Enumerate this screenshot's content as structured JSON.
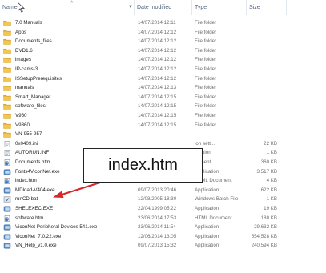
{
  "header": {
    "name": "Name",
    "date_modified": "Date modified",
    "type": "Type",
    "size": "Size",
    "sort_indicator": "^"
  },
  "rows": [
    {
      "name": "7.0 Manuals",
      "date": "14/07/2014 12:11",
      "type": "File folder",
      "size": "",
      "icon": "folder-icon"
    },
    {
      "name": "Apps",
      "date": "14/07/2014 12:12",
      "type": "File folder",
      "size": "",
      "icon": "folder-icon"
    },
    {
      "name": "Documents_files",
      "date": "14/07/2014 12:12",
      "type": "File folder",
      "size": "",
      "icon": "folder-icon"
    },
    {
      "name": "DVD1.6",
      "date": "14/07/2014 12:12",
      "type": "File folder",
      "size": "",
      "icon": "folder-icon"
    },
    {
      "name": "images",
      "date": "14/07/2014 12:12",
      "type": "File folder",
      "size": "",
      "icon": "folder-icon"
    },
    {
      "name": "IP-cams-3",
      "date": "14/07/2014 12:12",
      "type": "File folder",
      "size": "",
      "icon": "folder-icon"
    },
    {
      "name": "ISSetupPrerequisites",
      "date": "14/07/2014 12:12",
      "type": "File folder",
      "size": "",
      "icon": "folder-icon"
    },
    {
      "name": "manuals",
      "date": "14/07/2014 12:13",
      "type": "File folder",
      "size": "",
      "icon": "folder-icon"
    },
    {
      "name": "Smart_Manager",
      "date": "14/07/2014 12:15",
      "type": "File folder",
      "size": "",
      "icon": "folder-icon"
    },
    {
      "name": "software_files",
      "date": "14/07/2014 12:15",
      "type": "File folder",
      "size": "",
      "icon": "folder-icon"
    },
    {
      "name": "V960",
      "date": "14/07/2014 12:15",
      "type": "File folder",
      "size": "",
      "icon": "folder-icon"
    },
    {
      "name": "V9360",
      "date": "14/07/2014 12:15",
      "type": "File folder",
      "size": "",
      "icon": "folder-icon"
    },
    {
      "name": "VN-955-957",
      "date": "",
      "type": "",
      "size": "",
      "icon": "folder-icon"
    },
    {
      "name": "0x0409.ini",
      "date": "",
      "type": "ion sett...",
      "size": "22 KB",
      "icon": "config-file-icon"
    },
    {
      "name": "AUTORUN.INF",
      "date": "",
      "type": "rmation",
      "size": "1 KB",
      "icon": "config-file-icon"
    },
    {
      "name": "Documents.htm",
      "date": "",
      "type": "cument",
      "size": "360 KB",
      "icon": "html-file-icon"
    },
    {
      "name": "Fonts4ViconNet.exe",
      "date": "05/11/2012 15:03",
      "type": "Application",
      "size": "3,517 KB",
      "icon": "app-icon"
    },
    {
      "name": "index.htm",
      "date": "22/01/2014 18:40",
      "type": "HTML Document",
      "size": "4 KB",
      "icon": "html-file-icon"
    },
    {
      "name": "MDload-V404.exe",
      "date": "09/07/2013 20:46",
      "type": "Application",
      "size": "622 KB",
      "icon": "app-icon"
    },
    {
      "name": "runCD.bat",
      "date": "12/08/2005 18:30",
      "type": "Windows Batch File",
      "size": "1 KB",
      "icon": "batch-file-icon"
    },
    {
      "name": "SHELEXEC.EXE",
      "date": "22/04/1999 05:22",
      "type": "Application",
      "size": "19 KB",
      "icon": "app-icon"
    },
    {
      "name": "software.htm",
      "date": "23/06/2014 17:53",
      "type": "HTML Document",
      "size": "180 KB",
      "icon": "html-file-icon"
    },
    {
      "name": "ViconNet Peripheral Devices 541.exe",
      "date": "23/06/2014 11:54",
      "type": "Application",
      "size": "29,632 KB",
      "icon": "app-icon"
    },
    {
      "name": "ViconNet_7.0.22.exe",
      "date": "12/06/2014 13:05",
      "type": "Application",
      "size": "554,528 KB",
      "icon": "app-icon"
    },
    {
      "name": "VN_Help_v1.0.exe",
      "date": "09/07/2013 15:32",
      "type": "Application",
      "size": "240,594 KB",
      "icon": "app-icon"
    }
  ],
  "callout": {
    "text": "index.htm"
  },
  "colors": {
    "folder": "#e8b33c",
    "arrow": "#d9262a",
    "header_text": "#4c607a"
  }
}
